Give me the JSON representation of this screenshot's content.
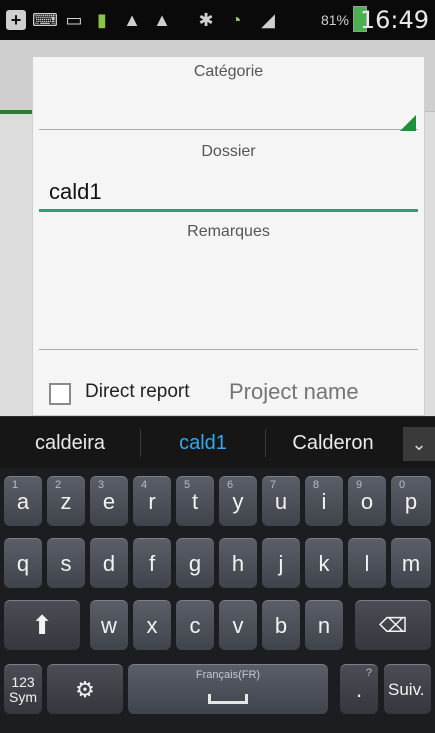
{
  "status_bar": {
    "battery_percent": "81%",
    "time": "16:49",
    "icons": [
      "add-box-icon",
      "keyboard-icon",
      "screen-share-icon",
      "battery-saver-icon",
      "warning-icon",
      "warning-icon",
      "bluetooth-icon",
      "wifi-icon",
      "signal-icon",
      "battery-charging-icon"
    ]
  },
  "form": {
    "category_label": "Catégorie",
    "folder_label": "Dossier",
    "folder_value": "cald1",
    "remarks_label": "Remarques",
    "direct_report_label": "Direct report",
    "project_name_placeholder": "Project name"
  },
  "suggestions": {
    "items": [
      "caldeira",
      "cald1",
      "Calderon"
    ],
    "selected_index": 1
  },
  "keyboard": {
    "row1": [
      {
        "key": "a",
        "sup": "1"
      },
      {
        "key": "z",
        "sup": "2"
      },
      {
        "key": "e",
        "sup": "3"
      },
      {
        "key": "r",
        "sup": "4"
      },
      {
        "key": "t",
        "sup": "5"
      },
      {
        "key": "y",
        "sup": "6"
      },
      {
        "key": "u",
        "sup": "7"
      },
      {
        "key": "i",
        "sup": "8"
      },
      {
        "key": "o",
        "sup": "9"
      },
      {
        "key": "p",
        "sup": "0"
      }
    ],
    "row2": [
      "q",
      "s",
      "d",
      "f",
      "g",
      "h",
      "j",
      "k",
      "l",
      "m"
    ],
    "row3": [
      "w",
      "x",
      "c",
      "v",
      "b",
      "n"
    ],
    "sym_label_top": "123",
    "sym_label_bottom": "Sym",
    "space_label": "Français(FR)",
    "period_key": ".",
    "period_sup": "?",
    "next_label": "Suiv."
  },
  "colors": {
    "accent_green": "#26a17a",
    "suggestion_selected": "#3aa7e8"
  }
}
